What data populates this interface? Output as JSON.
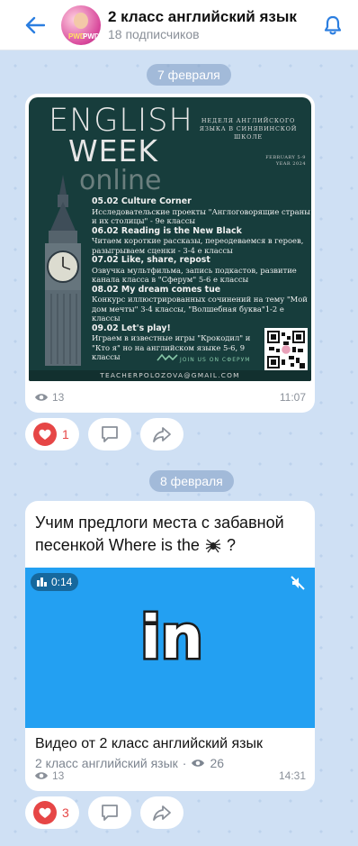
{
  "header": {
    "title": "2 класс английский язык",
    "subtitle": "18 подписчиков",
    "avatar_text_1": "PWD",
    "avatar_text_2": "PWD"
  },
  "colors": {
    "accent": "#2b7ee0",
    "like": "#e64646",
    "chat_bg": "#cfe0f4",
    "poster_bg": "#173d3c",
    "video_bg": "#23a0f2"
  },
  "icons": [
    "back-arrow-icon",
    "bell-icon",
    "eye-icon",
    "heart-icon",
    "comment-icon",
    "share-icon",
    "audio-bars-icon",
    "mute-icon",
    "spider-icon"
  ],
  "posts": [
    {
      "date": "7 февраля",
      "poster": {
        "title_1": "ENGLISH",
        "title_2": "WEEK",
        "title_3": "online",
        "right_text": "НЕДЕЛЯ АНГЛИЙСКОГО ЯЗЫКА В СИНЯВИНСКОЙ ШКОЛЕ",
        "date_line_1": "FEBRUARY 5-9",
        "date_line_2": "YEAR 2024",
        "lines": [
          {
            "text": "05.02  Culture Corner",
            "heading": true
          },
          {
            "text": "Исследовательские проекты \"Англоговорящие страны и их столицы\" - 9е классы",
            "heading": false
          },
          {
            "text": "06.02 Reading is the New Black",
            "heading": true
          },
          {
            "text": "Читаем короткие рассказы, переодеваемся в героев, разыгрываем сценки - 3-4 е классы",
            "heading": false
          },
          {
            "text": "07.02 Like, share, repost",
            "heading": true
          },
          {
            "text": "Озвучка мультфильма, запись подкастов, развитие канала класса в \"Сферум\" 5-6 е классы",
            "heading": false
          },
          {
            "text": "08.02 My dream comes tue",
            "heading": true
          },
          {
            "text": "Конкурс иллюстрированных сочинений на тему \"Мой дом мечты\" 3-4 классы, \"Волшебная буква\"1-2 е классы",
            "heading": false
          },
          {
            "text": "09.02 Let's play!",
            "heading": true
          },
          {
            "text": "Играем в известные игры \"Крокодил\" и \"Кто я\" но на английском языке 5-6, 9 классы",
            "heading": false
          }
        ],
        "join": "JOIN US ON СФЕРУМ",
        "email": "TEACHERPOLOZOVA@GMAIL.COM"
      },
      "views": "13",
      "time": "11:07",
      "likes": "1"
    },
    {
      "date": "8 февраля",
      "text": "Учим предлоги места с забавной песенкой Where is the",
      "text_end": "?",
      "video": {
        "duration": "0:14",
        "logo": "in"
      },
      "video_title": "Видео от 2 класс английский язык",
      "video_channel": "2 класс английский язык",
      "video_separator": "·",
      "video_views": "26",
      "views": "13",
      "time": "14:31",
      "likes": "3"
    }
  ]
}
